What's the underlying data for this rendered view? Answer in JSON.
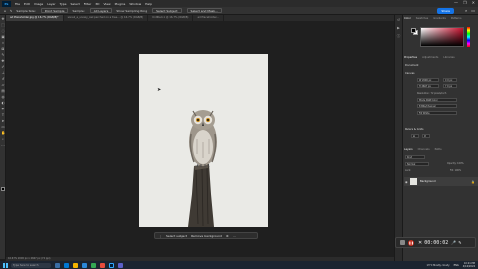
{
  "app": {
    "logo": "Ps",
    "menu": [
      "File",
      "Edit",
      "Image",
      "Layer",
      "Type",
      "Select",
      "Filter",
      "3D",
      "View",
      "Plugins",
      "Window",
      "Help"
    ],
    "window_controls": [
      "—",
      "❐",
      "✕"
    ]
  },
  "options_bar": {
    "items": [
      "Sample Size:",
      "Point Sample",
      "Sample:",
      "All Layers",
      "Show Sampling Ring"
    ],
    "buttons": [
      "Select Subject",
      "Select and Mask..."
    ],
    "share_label": "Share"
  },
  "doc_tabs": [
    {
      "label": "ad Placeholder.jpg @ 16.7% (RGB/8)*",
      "active": true
    },
    {
      "label": "soneli_a_snowy_owl perched on a tree... @ 16.7% (RGB/8)",
      "active": false
    },
    {
      "label": "Untitled-1 @ 16.7% (RGB/8)",
      "active": false
    },
    {
      "label": "ad Placeholder...",
      "active": false
    }
  ],
  "contextual_bar": {
    "select_subject": "Select subject",
    "remove_bg": "Remove background"
  },
  "status_text": "16.67%    2000 px x 2667 px (72 ppi)",
  "panels": {
    "top_tabs": [
      "Color",
      "Swatches",
      "Gradients",
      "Patterns"
    ],
    "props_tabs": [
      "Properties",
      "Adjustments",
      "Libraries"
    ],
    "document_label": "Document",
    "canvas_label": "Canvas",
    "width": "W 2000 px",
    "height": "H 2667 px",
    "x": "X 0 px",
    "y": "Y 0 px",
    "resolution": "Resolution: 72 pixels/inch",
    "mode": "Mode  RGB Color",
    "bit_depth": "8 Bits/Channel",
    "fill": "Fill  White",
    "rulers_label": "Rulers & Grids",
    "layers_tabs": [
      "Layers",
      "Channels",
      "Paths"
    ],
    "layer_kind": "Kind",
    "blend": "Normal",
    "opacity": "Opacity: 100%",
    "fill_pct": "Fill: 100%",
    "lock_label": "Lock:",
    "layer_name": "Background"
  },
  "recorder": {
    "time": "00:00:02"
  },
  "taskbar": {
    "search_placeholder": "Type here to search",
    "weather": "13°C  Mostly cloudy",
    "lang": "ENG",
    "time": "10:21 PM",
    "date": "4/16/2024"
  },
  "colors": {
    "accent": "#1473e6",
    "record": "#c42b1c"
  }
}
